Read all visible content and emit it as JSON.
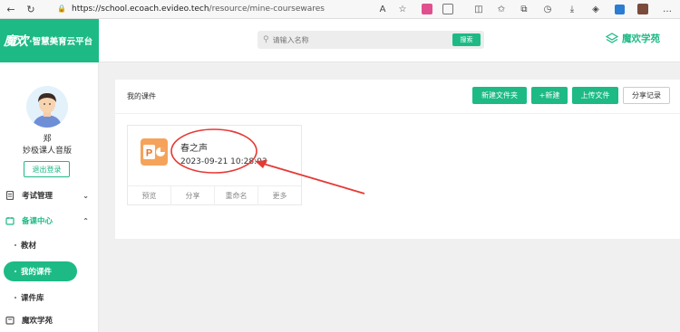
{
  "browser": {
    "url_host": "https://school.ecoach.evideo.tech",
    "url_path": "/resource/mine-coursewares"
  },
  "header": {
    "logo_text": "魔欢",
    "brand_name": "·智慧美育云平台",
    "search_placeholder": "请输入名称",
    "search_button": "搜索",
    "right_brand": "魔欢学苑",
    "accent": "#1dba86"
  },
  "user": {
    "name": "郑",
    "role": "妙极课人音版",
    "logout_label": "退出登录"
  },
  "sidebar": {
    "menu_exam": "考试管理",
    "menu_prep": "备课中心",
    "sub_textbook": "教材",
    "sub_mine": "我的课件",
    "sub_library": "课件库",
    "menu_academy": "魔欢学苑"
  },
  "main": {
    "title": "我的课件",
    "btn_new_folder": "新建文件夹",
    "btn_new": "+新建",
    "btn_upload": "上传文件",
    "btn_share_log": "分享记录"
  },
  "card": {
    "title": "春之声",
    "date": "2023-09-21 10:28:03",
    "icon_letter": "P",
    "actions": [
      "预览",
      "分享",
      "重命名",
      "更多"
    ]
  }
}
